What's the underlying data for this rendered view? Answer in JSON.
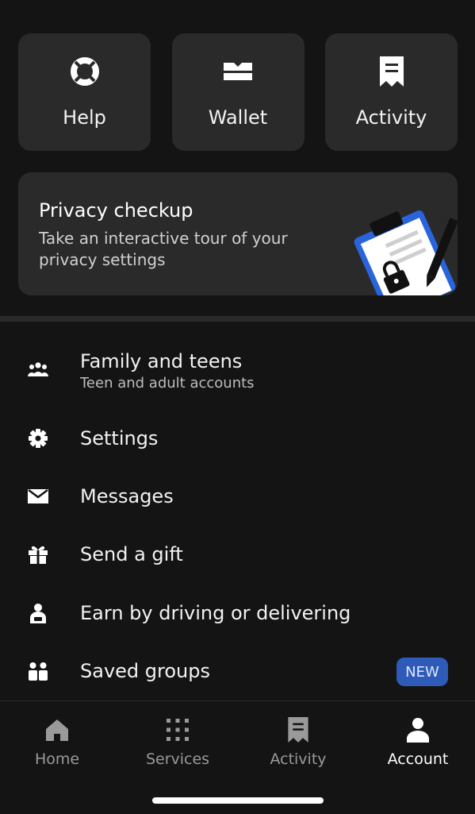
{
  "tiles": [
    {
      "label": "Help",
      "icon": "lifebuoy-icon"
    },
    {
      "label": "Wallet",
      "icon": "wallet-icon"
    },
    {
      "label": "Activity",
      "icon": "receipt-icon"
    }
  ],
  "privacy": {
    "title": "Privacy checkup",
    "description": "Take an interactive tour of your privacy settings",
    "illustration": "clipboard-lock-icon"
  },
  "menu": [
    {
      "label": "Family and teens",
      "sublabel": "Teen and adult accounts",
      "icon": "family-icon"
    },
    {
      "label": "Settings",
      "icon": "gear-icon"
    },
    {
      "label": "Messages",
      "icon": "envelope-icon"
    },
    {
      "label": "Send a gift",
      "icon": "gift-icon"
    },
    {
      "label": "Earn by driving or delivering",
      "icon": "driver-icon"
    },
    {
      "label": "Saved groups",
      "icon": "group-icon",
      "badge": "NEW"
    }
  ],
  "tabbar": [
    {
      "label": "Home",
      "icon": "home-icon",
      "active": false
    },
    {
      "label": "Services",
      "icon": "grid-icon",
      "active": false
    },
    {
      "label": "Activity",
      "icon": "receipt-icon",
      "active": false
    },
    {
      "label": "Account",
      "icon": "person-icon",
      "active": true
    }
  ],
  "colors": {
    "background": "#141414",
    "card": "#2a2a2a",
    "badge": "#2e5bb8",
    "inactive_tab": "#9a9a9a",
    "active_tab": "#ffffff"
  }
}
